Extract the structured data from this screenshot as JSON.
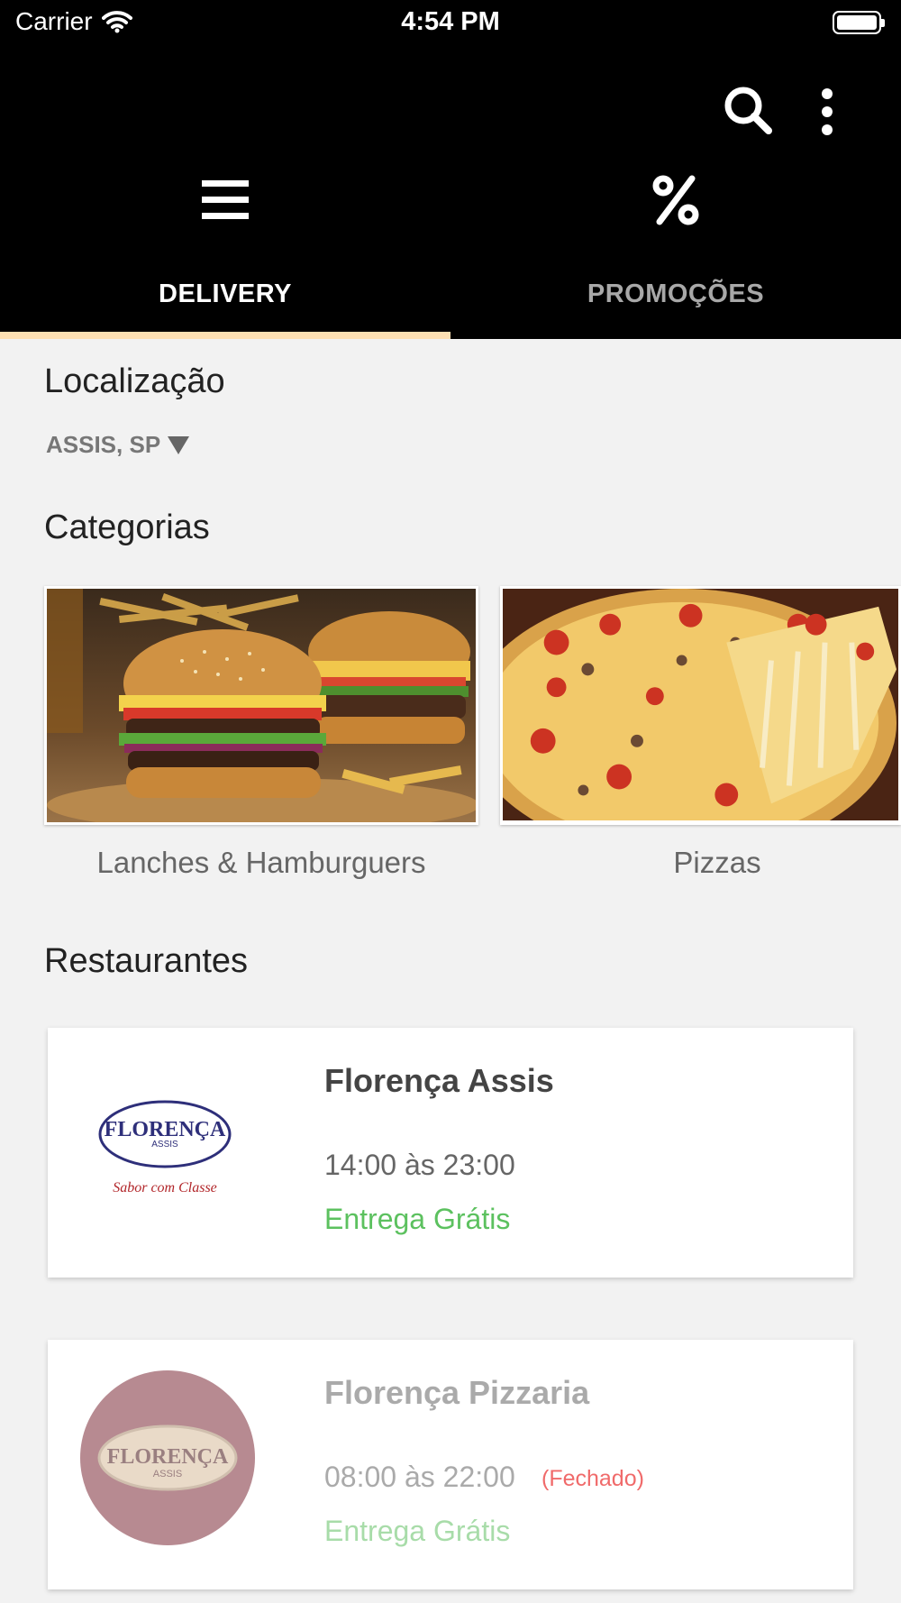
{
  "status_bar": {
    "carrier": "Carrier",
    "time": "4:54 PM"
  },
  "tabs": [
    {
      "label": "DELIVERY",
      "icon": "menu-icon",
      "active": true
    },
    {
      "label": "PROMOÇÕES",
      "icon": "percent-icon",
      "active": false
    }
  ],
  "location": {
    "title": "Localização",
    "value": "ASSIS, SP"
  },
  "categories": {
    "title": "Categorias",
    "items": [
      {
        "label": "Lanches & Hamburguers",
        "image": "burger-photo"
      },
      {
        "label": "Pizzas",
        "image": "pizza-photo"
      }
    ]
  },
  "restaurants": {
    "title": "Restaurantes",
    "items": [
      {
        "name": "Florença Assis",
        "hours": "14:00 às 23:00",
        "delivery": "Entrega Grátis",
        "status": "",
        "logo": {
          "brand": "FLORENÇA",
          "sub": "ASSIS",
          "tagline": "Sabor com Classe"
        }
      },
      {
        "name": "Florença Pizzaria",
        "hours": "08:00 às 22:00",
        "delivery": "Entrega Grátis",
        "status": "(Fechado)",
        "logo": {
          "brand": "FLORENÇA",
          "sub": "ASSIS"
        }
      }
    ]
  },
  "colors": {
    "header_bg": "#000000",
    "tab_indicator": "#fde0b3",
    "free_delivery": "#5cc15f",
    "closed": "#f06a6a",
    "page_bg": "#f2f2f2"
  }
}
